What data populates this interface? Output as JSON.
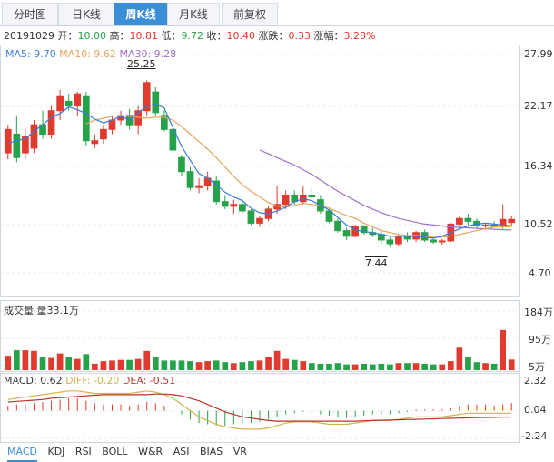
{
  "tabs": {
    "items": [
      "分时图",
      "日K线",
      "周K线",
      "月K线"
    ],
    "active": "周K线",
    "fuquan": "前复权"
  },
  "info": {
    "date": "20191029",
    "open_label": "开：",
    "open": "10.00",
    "high_label": "高：",
    "high": "10.81",
    "low_label": "低：",
    "low": "9.72",
    "close_label": "收：",
    "close": "10.40",
    "chg_label": "涨跌：",
    "chg": "0.33",
    "pct_label": "涨幅：",
    "pct": "3.28%"
  },
  "ma_legend": {
    "ma5": "MA5: 9.70",
    "ma10": "MA10: 9.62",
    "ma30": "MA30: 9.28"
  },
  "colors": {
    "up": "#e03b2f",
    "down": "#26a34a",
    "ma5": "#3a7bd5",
    "ma10": "#e6a35a",
    "ma30": "#a070c6",
    "dif": "#d4b34a",
    "dea": "#b8342a"
  },
  "price_axis": [
    "27.99",
    "22.17",
    "16.34",
    "10.52",
    "4.70"
  ],
  "price_marks": {
    "high": "25.25",
    "low": "7.44"
  },
  "volume": {
    "legend": "成交量 量33.1万",
    "axis": [
      "184万",
      "95万",
      "5万"
    ]
  },
  "macd": {
    "legend_label": "MACD: 0.62",
    "dif_label": "DIFF: -0.20",
    "dea_label": "DEA: -0.51",
    "axis": [
      "2.32",
      "0.04",
      "-2.24"
    ]
  },
  "indicator_tabs": [
    "MACD",
    "KDJ",
    "RSI",
    "BOLL",
    "W&R",
    "ASI",
    "BIAS",
    "VR"
  ],
  "active_indicator": "MACD",
  "chart_data": {
    "type": "candlestick",
    "ylim": [
      4.7,
      27.99
    ],
    "candles": [
      [
        17.5,
        20.5,
        16.8,
        20.0
      ],
      [
        19.5,
        21.5,
        16.5,
        17.0
      ],
      [
        17.5,
        20.0,
        16.8,
        19.2
      ],
      [
        18.0,
        21.0,
        17.5,
        20.5
      ],
      [
        20.5,
        22.0,
        19.0,
        19.5
      ],
      [
        19.5,
        22.5,
        19.0,
        22.0
      ],
      [
        22.0,
        24.2,
        21.0,
        23.5
      ],
      [
        23.0,
        23.8,
        22.0,
        22.5
      ],
      [
        22.5,
        24.0,
        21.5,
        23.8
      ],
      [
        23.5,
        24.0,
        18.2,
        18.8
      ],
      [
        18.5,
        19.5,
        18.0,
        18.8
      ],
      [
        19.0,
        20.5,
        18.5,
        20.0
      ],
      [
        20.0,
        21.5,
        19.5,
        21.0
      ],
      [
        21.0,
        22.0,
        20.5,
        21.5
      ],
      [
        21.5,
        22.2,
        20.0,
        20.5
      ],
      [
        20.5,
        22.5,
        19.5,
        22.0
      ],
      [
        22.0,
        25.25,
        21.5,
        25.0
      ],
      [
        24.0,
        24.5,
        21.5,
        21.8
      ],
      [
        21.5,
        22.0,
        19.8,
        20.0
      ],
      [
        20.0,
        20.5,
        17.5,
        17.8
      ],
      [
        17.0,
        17.3,
        15.0,
        15.5
      ],
      [
        15.5,
        16.0,
        13.5,
        13.8
      ],
      [
        13.8,
        14.8,
        13.2,
        14.0
      ],
      [
        14.0,
        15.5,
        13.5,
        14.8
      ],
      [
        14.5,
        15.0,
        12.0,
        12.3
      ],
      [
        12.3,
        13.0,
        11.5,
        11.8
      ],
      [
        11.8,
        12.5,
        11.0,
        12.0
      ],
      [
        12.0,
        12.5,
        11.0,
        11.3
      ],
      [
        11.3,
        11.5,
        9.8,
        10.0
      ],
      [
        10.0,
        10.8,
        9.6,
        10.5
      ],
      [
        10.5,
        11.8,
        10.2,
        11.5
      ],
      [
        11.5,
        14.0,
        11.0,
        12.0
      ],
      [
        12.0,
        13.5,
        11.5,
        13.0
      ],
      [
        13.0,
        13.5,
        12.0,
        12.3
      ],
      [
        12.3,
        14.0,
        12.0,
        13.0
      ],
      [
        13.0,
        13.8,
        12.5,
        12.8
      ],
      [
        12.5,
        13.0,
        11.0,
        11.3
      ],
      [
        11.3,
        11.5,
        10.0,
        10.2
      ],
      [
        10.2,
        10.5,
        9.0,
        9.2
      ],
      [
        9.2,
        9.5,
        8.2,
        8.6
      ],
      [
        8.6,
        9.8,
        8.5,
        9.6
      ],
      [
        9.6,
        9.8,
        8.8,
        9.0
      ],
      [
        9.0,
        9.5,
        8.5,
        8.8
      ],
      [
        8.8,
        9.3,
        7.8,
        8.2
      ],
      [
        8.2,
        8.5,
        7.44,
        7.8
      ],
      [
        7.8,
        8.8,
        7.6,
        8.6
      ],
      [
        8.6,
        9.0,
        8.0,
        8.3
      ],
      [
        8.3,
        9.2,
        8.0,
        9.0
      ],
      [
        9.0,
        9.3,
        8.0,
        8.2
      ],
      [
        8.2,
        8.5,
        7.8,
        8.0
      ],
      [
        8.0,
        8.3,
        7.7,
        8.1
      ],
      [
        8.1,
        10.0,
        8.0,
        9.9
      ],
      [
        9.9,
        10.8,
        9.5,
        10.5
      ],
      [
        10.5,
        11.0,
        9.8,
        10.2
      ],
      [
        10.2,
        10.5,
        9.5,
        9.7
      ],
      [
        9.7,
        10.0,
        9.3,
        9.8
      ],
      [
        9.8,
        10.2,
        9.5,
        9.6
      ],
      [
        9.6,
        12.0,
        9.4,
        10.4
      ],
      [
        10.07,
        10.81,
        9.72,
        10.4
      ]
    ],
    "ma5": [
      18.5,
      18.8,
      19.0,
      19.8,
      20.5,
      21.3,
      21.7,
      22.4,
      22.1,
      21.7,
      21.1,
      20.7,
      21.0,
      21.4,
      21.0,
      21.8,
      22.5,
      22.7,
      22.3,
      20.2,
      18.2,
      16.7,
      15.3,
      14.8,
      14.1,
      13.3,
      12.8,
      12.4,
      11.6,
      11.1,
      11.0,
      11.3,
      11.7,
      12.3,
      12.6,
      12.4,
      11.9,
      11.4,
      10.6,
      9.8,
      9.3,
      9.1,
      9.0,
      8.8,
      8.6,
      8.6,
      8.6,
      8.6,
      8.5,
      8.4,
      8.6,
      9.0,
      9.4,
      9.7,
      9.9,
      10.0,
      9.9,
      9.8,
      9.7
    ],
    "ma10": [
      null,
      null,
      null,
      null,
      null,
      null,
      null,
      null,
      null,
      20.6,
      21.0,
      21.2,
      21.4,
      21.5,
      21.4,
      21.3,
      21.2,
      21.3,
      21.3,
      21.0,
      20.3,
      19.5,
      18.7,
      17.9,
      17.0,
      16.0,
      15.0,
      14.1,
      13.4,
      12.8,
      12.2,
      11.8,
      11.7,
      11.9,
      12.1,
      12.0,
      11.9,
      11.6,
      11.2,
      10.8,
      10.5,
      10.0,
      9.6,
      9.2,
      9.0,
      8.8,
      8.7,
      8.7,
      8.6,
      8.5,
      8.5,
      8.6,
      8.8,
      9.0,
      9.2,
      9.4,
      9.6,
      9.6,
      9.62
    ],
    "ma30": [
      null,
      null,
      null,
      null,
      null,
      null,
      null,
      null,
      null,
      null,
      null,
      null,
      null,
      null,
      null,
      null,
      null,
      null,
      null,
      null,
      null,
      null,
      null,
      null,
      null,
      null,
      null,
      null,
      null,
      17.8,
      17.4,
      17.0,
      16.6,
      16.2,
      15.7,
      15.2,
      14.6,
      14.0,
      13.4,
      12.9,
      12.4,
      11.9,
      11.5,
      11.1,
      10.8,
      10.5,
      10.3,
      10.1,
      9.9,
      9.8,
      9.7,
      9.6,
      9.55,
      9.5,
      9.45,
      9.4,
      9.35,
      9.3,
      9.28
    ],
    "volume": [
      45,
      62,
      62,
      60,
      40,
      38,
      52,
      40,
      35,
      50,
      20,
      28,
      30,
      32,
      32,
      35,
      60,
      40,
      30,
      30,
      30,
      28,
      25,
      28,
      30,
      25,
      22,
      25,
      28,
      30,
      40,
      60,
      35,
      32,
      28,
      22,
      20,
      20,
      22,
      18,
      18,
      20,
      18,
      20,
      18,
      22,
      22,
      22,
      20,
      18,
      18,
      28,
      70,
      40,
      25,
      22,
      20,
      125,
      33.1
    ],
    "macd_bars": [
      0.4,
      0.5,
      0.5,
      0.6,
      0.7,
      0.8,
      0.9,
      1.0,
      1.0,
      0.8,
      0.6,
      0.5,
      0.5,
      0.5,
      0.4,
      0.5,
      0.7,
      0.6,
      0.4,
      0.1,
      -0.3,
      -0.7,
      -1.0,
      -1.1,
      -1.2,
      -1.2,
      -1.1,
      -1.0,
      -1.0,
      -0.9,
      -0.7,
      -0.5,
      -0.3,
      -0.2,
      -0.1,
      -0.2,
      -0.3,
      -0.4,
      -0.5,
      -0.6,
      -0.5,
      -0.4,
      -0.3,
      -0.3,
      -0.3,
      -0.2,
      -0.1,
      0.1,
      0.1,
      0.1,
      0.1,
      0.2,
      0.4,
      0.5,
      0.5,
      0.5,
      0.4,
      0.5,
      0.62
    ],
    "dif": [
      0.9,
      1.0,
      1.1,
      1.2,
      1.3,
      1.4,
      1.5,
      1.6,
      1.6,
      1.5,
      1.4,
      1.4,
      1.4,
      1.4,
      1.4,
      1.5,
      1.6,
      1.5,
      1.3,
      1.0,
      0.5,
      0.0,
      -0.5,
      -0.8,
      -1.1,
      -1.3,
      -1.4,
      -1.5,
      -1.5,
      -1.5,
      -1.4,
      -1.2,
      -1.0,
      -0.9,
      -0.9,
      -0.9,
      -1.0,
      -1.1,
      -1.1,
      -1.1,
      -1.0,
      -0.9,
      -0.8,
      -0.8,
      -0.8,
      -0.7,
      -0.6,
      -0.5,
      -0.5,
      -0.5,
      -0.5,
      -0.4,
      -0.3,
      -0.2,
      -0.2,
      -0.2,
      -0.2,
      -0.2,
      -0.2
    ],
    "dea": [
      0.7,
      0.75,
      0.8,
      0.85,
      0.9,
      1.0,
      1.05,
      1.1,
      1.15,
      1.2,
      1.25,
      1.3,
      1.3,
      1.3,
      1.3,
      1.3,
      1.3,
      1.35,
      1.35,
      1.3,
      1.2,
      1.0,
      0.8,
      0.5,
      0.2,
      -0.1,
      -0.3,
      -0.5,
      -0.6,
      -0.7,
      -0.8,
      -0.85,
      -0.85,
      -0.85,
      -0.85,
      -0.85,
      -0.85,
      -0.85,
      -0.85,
      -0.85,
      -0.85,
      -0.82,
      -0.8,
      -0.78,
      -0.76,
      -0.74,
      -0.72,
      -0.7,
      -0.68,
      -0.66,
      -0.64,
      -0.62,
      -0.6,
      -0.58,
      -0.56,
      -0.55,
      -0.54,
      -0.52,
      -0.51
    ]
  }
}
